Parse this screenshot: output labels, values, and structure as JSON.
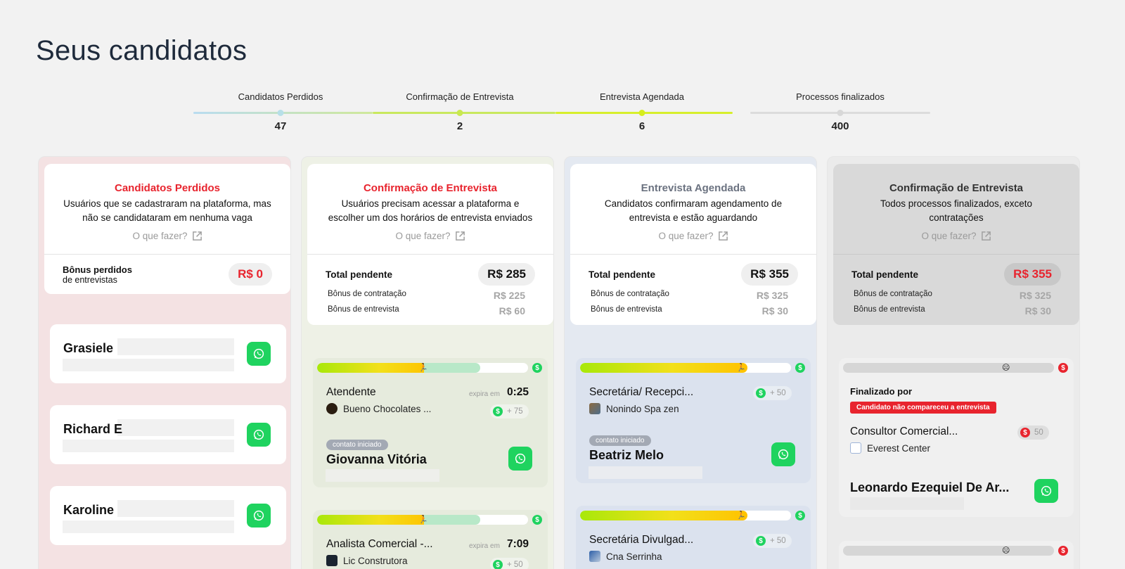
{
  "page": {
    "title": "Seus candidatos"
  },
  "stepper": {
    "steps": [
      {
        "label": "Candidatos Perdidos",
        "count": "47"
      },
      {
        "label": "Confirmação de Entrevista",
        "count": "2"
      },
      {
        "label": "Entrevista Agendada",
        "count": "6"
      },
      {
        "label": "Processos finalizados",
        "count": "400"
      }
    ]
  },
  "colors": {
    "red": "#e8242e",
    "green": "#1fd35f",
    "slate": "#6b7280"
  },
  "columns": {
    "lost": {
      "title": "Candidatos Perdidos",
      "desc1": "Usuários que se cadastraram na plataforma, mas",
      "desc2": "não se candidataram em nenhuma vaga",
      "help": "O que fazer?",
      "bonus_label1": "Bônus perdidos",
      "bonus_label2": "de entrevistas",
      "bonus_value": "R$ 0",
      "cards": [
        {
          "name": "Grasiele"
        },
        {
          "name": "Richard E"
        },
        {
          "name": "Karoline"
        }
      ]
    },
    "confirm": {
      "title": "Confirmação de Entrevista",
      "desc1": "Usuários precisam acessar a plataforma e",
      "desc2": "escolher um dos horários de entrevista enviados",
      "help": "O que fazer?",
      "total_label": "Total pendente",
      "total_value": "R$ 285",
      "hire_label": "Bônus de contratação",
      "hire_value": "R$ 225",
      "interview_label": "Bônus de entrevista",
      "interview_value": "R$ 60",
      "cards": [
        {
          "job": "Atendente",
          "company": "Bueno Chocolates ...",
          "expira": "expira em",
          "timer": "0:25",
          "bonus": "+ 75",
          "status": "contato iniciado",
          "candidate": "Giovanna Vitória"
        },
        {
          "job": "Analista Comercial -...",
          "company": "Lic Construtora",
          "expira": "expira em",
          "timer": "7:09",
          "bonus": "+ 50"
        }
      ]
    },
    "scheduled": {
      "title": "Entrevista Agendada",
      "desc1": "Candidatos confirmaram agendamento de",
      "desc2": "entrevista e estão aguardando",
      "help": "O que fazer?",
      "total_label": "Total pendente",
      "total_value": "R$ 355",
      "hire_label": "Bônus de contratação",
      "hire_value": "R$ 325",
      "interview_label": "Bônus de entrevista",
      "interview_value": "R$ 30",
      "cards": [
        {
          "job": "Secretária/ Recepci...",
          "company": "Nonindo Spa zen",
          "bonus": "+ 50",
          "status": "contato iniciado",
          "candidate": "Beatriz Melo"
        },
        {
          "job": "Secretária Divulgad...",
          "company": "Cna Serrinha",
          "bonus": "+ 50"
        }
      ]
    },
    "finished": {
      "title": "Confirmação de Entrevista",
      "desc1": "Todos processos finalizados, exceto",
      "desc2": "contratações",
      "help": "O que fazer?",
      "total_label": "Total pendente",
      "total_value": "R$ 355",
      "hire_label": "Bônus de contratação",
      "hire_value": "R$ 325",
      "interview_label": "Bônus de entrevista",
      "interview_value": "R$ 30",
      "cards": [
        {
          "finished_by": "Finalizado por",
          "reason": "Candidato não compareceu a entrevista",
          "job": "Consultor Comercial...",
          "company": "Everest Center",
          "bonus": "50",
          "candidate": "Leonardo Ezequiel De Ar..."
        }
      ]
    }
  }
}
